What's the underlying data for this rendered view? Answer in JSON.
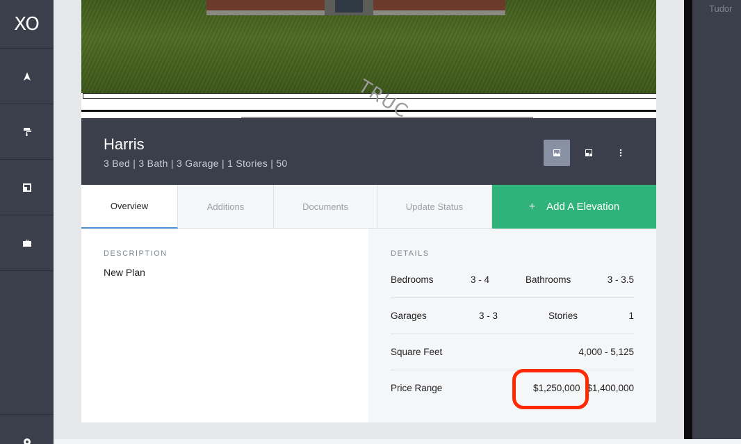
{
  "app": {
    "logo": "XO"
  },
  "sidebar": {
    "items": [
      {
        "icon": "location-arrow-icon"
      },
      {
        "icon": "paint-roller-icon"
      },
      {
        "icon": "floorplan-icon"
      },
      {
        "icon": "briefcase-icon"
      }
    ],
    "bottom_icon": "gear-icon"
  },
  "hero": {
    "watermark": "TRUC"
  },
  "plan": {
    "title": "Harris",
    "subtitle": "3 Bed | 3 Bath | 3 Garage | 1 Stories | 50"
  },
  "tabs": [
    {
      "label": "Overview",
      "active": true
    },
    {
      "label": "Additions"
    },
    {
      "label": "Documents"
    },
    {
      "label": "Update Status"
    }
  ],
  "add_button": {
    "plus": "+",
    "label": "Add A Elevation"
  },
  "description": {
    "label": "DESCRIPTION",
    "text": "New Plan"
  },
  "details": {
    "label": "DETAILS",
    "bedrooms_label": "Bedrooms",
    "bedrooms_value": "3 - 4",
    "bathrooms_label": "Bathrooms",
    "bathrooms_value": "3 - 3.5",
    "garages_label": "Garages",
    "garages_value": "3 - 3",
    "stories_label": "Stories",
    "stories_value": "1",
    "sqft_label": "Square Feet",
    "sqft_value": "4,000 - 5,125",
    "price_label": "Price Range",
    "price_min": "$1,250,000",
    "price_max": "$1,400,000"
  },
  "right_panel": {
    "label": "Tudor"
  },
  "colors": {
    "sidebar": "#3a3f4b",
    "accent_green": "#2fb37a",
    "highlight": "#ff2a00",
    "active_tab_border": "#4a90d9"
  }
}
